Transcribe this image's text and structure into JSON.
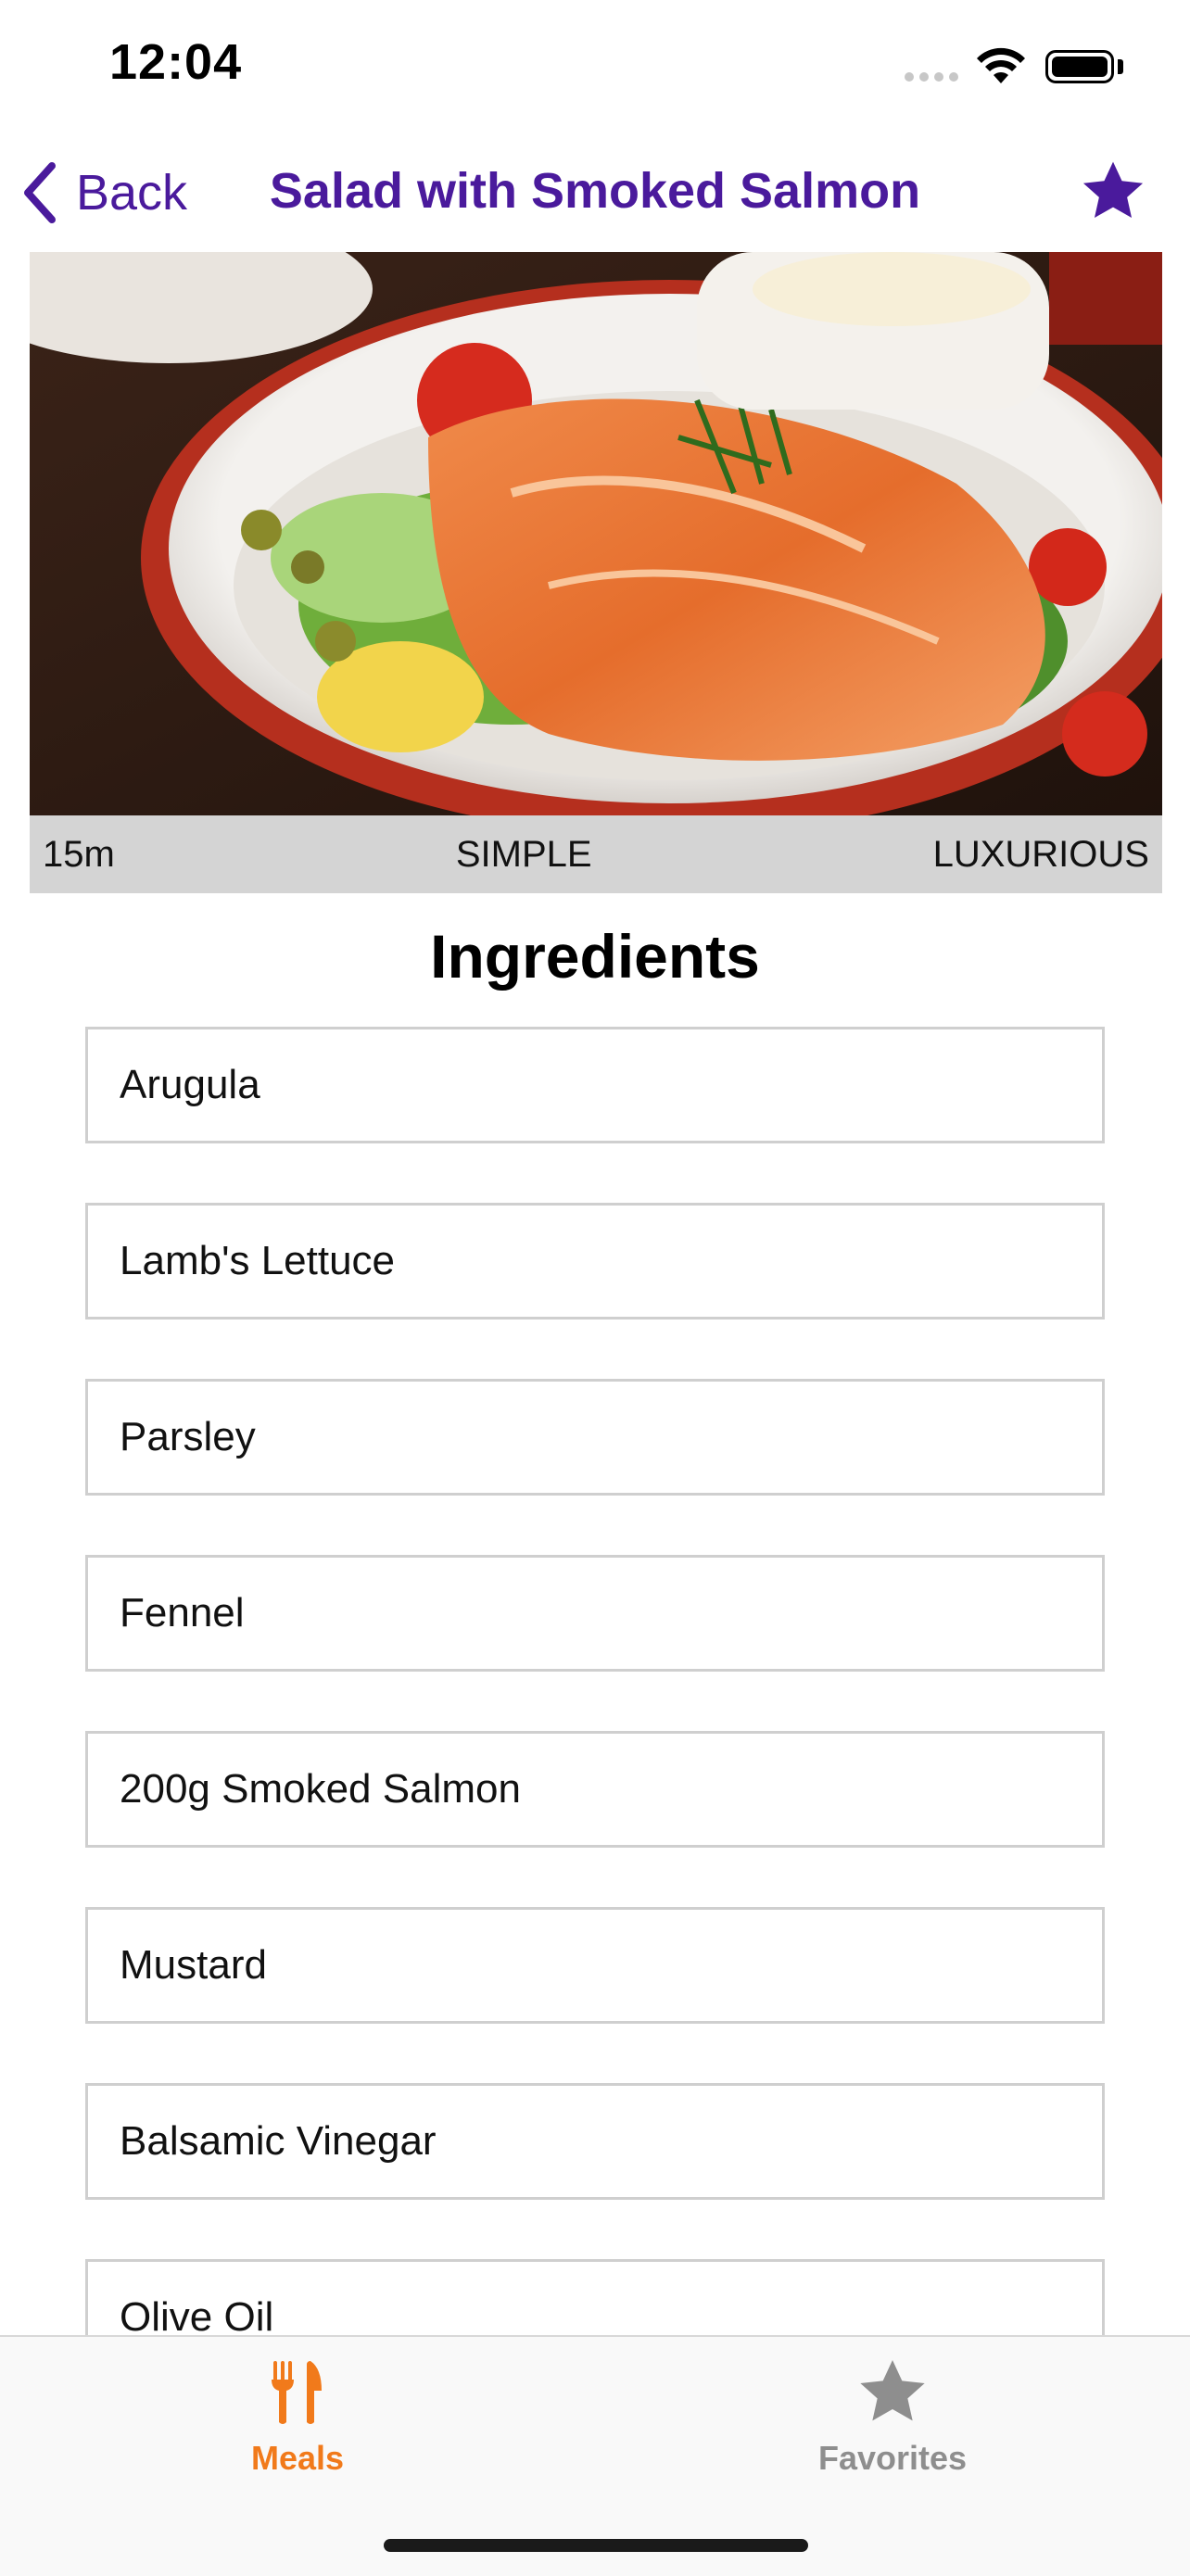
{
  "status_bar": {
    "time": "12:04"
  },
  "nav": {
    "back_label": "Back",
    "title": "Salad with Smoked Salmon",
    "favorite_icon": "star-icon",
    "accent": "#4a1a9c"
  },
  "meal": {
    "image_alt": "Salad with Smoked Salmon",
    "duration": "15m",
    "complexity": "SIMPLE",
    "affordability": "LUXURIOUS"
  },
  "ingredients_section": {
    "title": "Ingredients",
    "items": [
      "Arugula",
      "Lamb's Lettuce",
      "Parsley",
      "Fennel",
      "200g Smoked Salmon",
      "Mustard",
      "Balsamic Vinegar",
      "Olive Oil"
    ]
  },
  "tab_bar": {
    "active_color": "#f17a1b",
    "inactive_color": "#8e8e8e",
    "tabs": [
      {
        "label": "Meals",
        "icon": "fork-knife-icon",
        "active": true
      },
      {
        "label": "Favorites",
        "icon": "star-icon",
        "active": false
      }
    ]
  }
}
